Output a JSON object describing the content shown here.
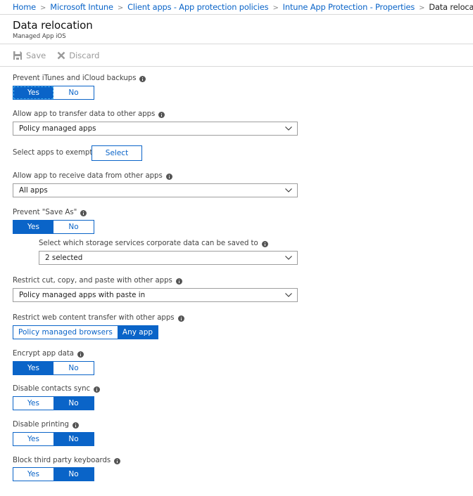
{
  "breadcrumb": {
    "items": [
      {
        "label": "Home",
        "link": true
      },
      {
        "label": "Microsoft Intune",
        "link": true
      },
      {
        "label": "Client apps - App protection policies",
        "link": true
      },
      {
        "label": "Intune App Protection - Properties",
        "link": true
      },
      {
        "label": "Data relocation",
        "link": false
      }
    ],
    "separator": ">"
  },
  "header": {
    "title": "Data relocation",
    "subtitle": "Managed App iOS"
  },
  "toolbar": {
    "save_label": "Save",
    "save_icon": "save-icon",
    "discard_label": "Discard",
    "discard_icon": "close-icon",
    "disabled_color": "#9a9a9a"
  },
  "colors": {
    "accent": "#0a64c8",
    "focus_outline": "#4ab4f0",
    "border": "#9e9e9e"
  },
  "settings": {
    "prevent_backups": {
      "label": "Prevent iTunes and iCloud backups",
      "options": [
        "Yes",
        "No"
      ],
      "selected": "Yes"
    },
    "transfer_data": {
      "label": "Allow app to transfer data to other apps",
      "value": "Policy managed apps"
    },
    "exempt_apps": {
      "label": "Select apps to exempt",
      "button": "Select"
    },
    "receive_data": {
      "label": "Allow app to receive data from other apps",
      "value": "All apps"
    },
    "prevent_save_as": {
      "label": "Prevent \"Save As\"",
      "options": [
        "Yes",
        "No"
      ],
      "selected": "Yes"
    },
    "storage_services": {
      "label": "Select which storage services corporate data can be saved to",
      "value": "2 selected"
    },
    "cut_copy_paste": {
      "label": "Restrict cut, copy, and paste with other apps",
      "value": "Policy managed apps with paste in"
    },
    "web_content": {
      "label": "Restrict web content transfer with other apps",
      "options": [
        "Policy managed browsers",
        "Any app"
      ],
      "selected": "Any app"
    },
    "encrypt_data": {
      "label": "Encrypt app data",
      "options": [
        "Yes",
        "No"
      ],
      "selected": "Yes"
    },
    "contacts_sync": {
      "label": "Disable contacts sync",
      "options": [
        "Yes",
        "No"
      ],
      "selected": "No"
    },
    "printing": {
      "label": "Disable printing",
      "options": [
        "Yes",
        "No"
      ],
      "selected": "No"
    },
    "third_party_keyboards": {
      "label": "Block third party keyboards",
      "options": [
        "Yes",
        "No"
      ],
      "selected": "No"
    }
  }
}
